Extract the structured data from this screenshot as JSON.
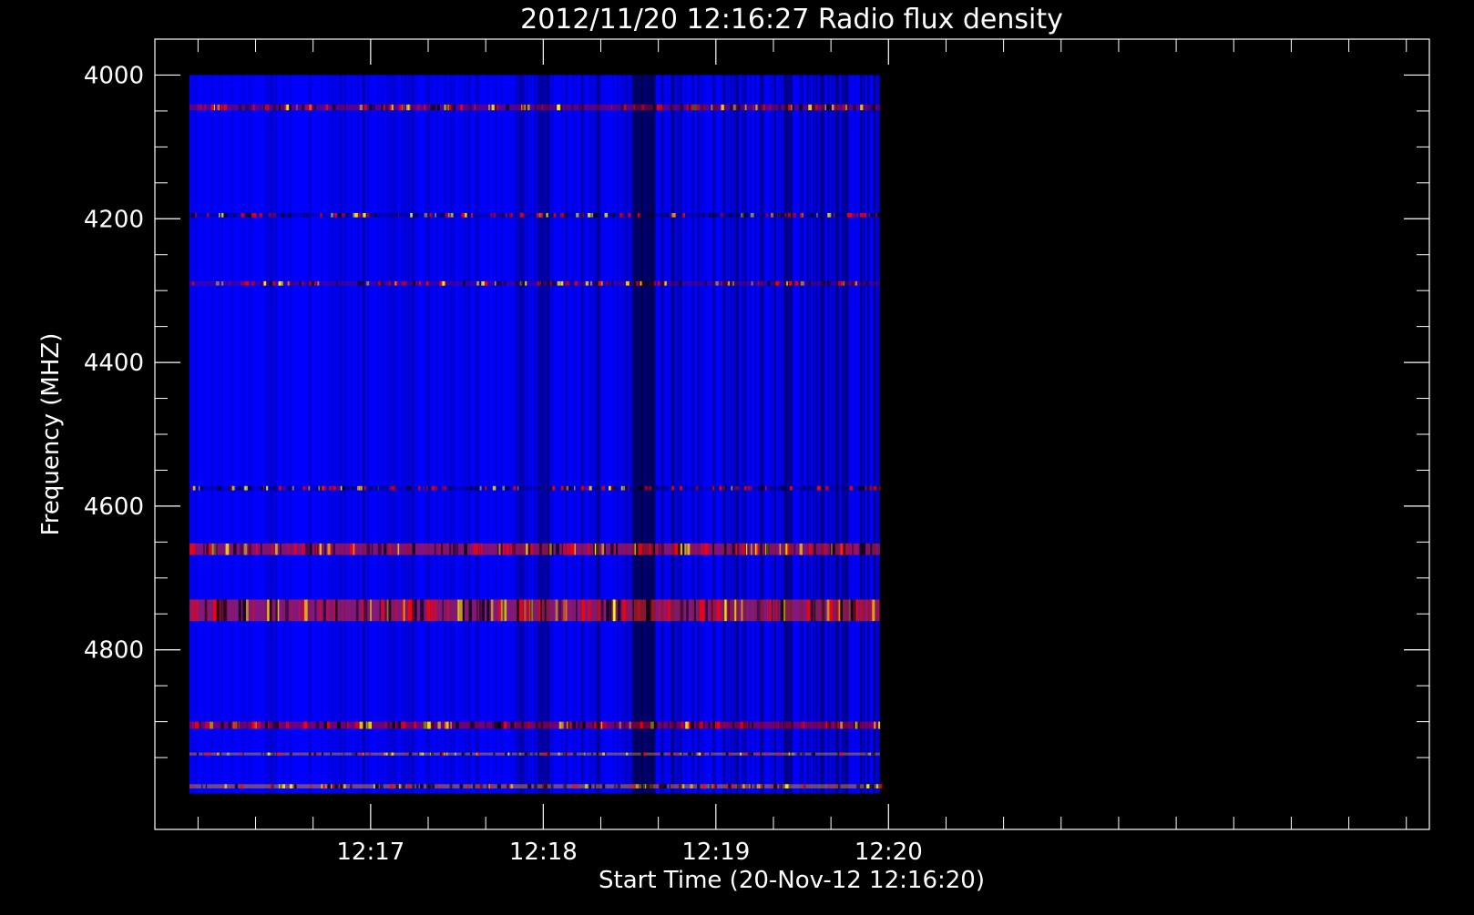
{
  "chart_data": {
    "type": "heatmap",
    "title": "2012/11/20 12:16:27 Radio flux density",
    "xlabel": "Start Time (20-Nov-12 12:16:20)",
    "ylabel": "Frequency (MHZ)",
    "ylim": [
      3950,
      5050
    ],
    "y_inverted": true,
    "xlim_seconds_after_start": [
      -35,
      408
    ],
    "y_ticks": [
      {
        "value": 4000,
        "label": "4000"
      },
      {
        "value": 4200,
        "label": "4200"
      },
      {
        "value": 4400,
        "label": "4400"
      },
      {
        "value": 4600,
        "label": "4600"
      },
      {
        "value": 4800,
        "label": "4800"
      }
    ],
    "y_minor_step": 50,
    "x_ticks": [
      {
        "value": 40,
        "label": "12:17"
      },
      {
        "value": 100,
        "label": "12:18"
      },
      {
        "value": 160,
        "label": "12:19"
      },
      {
        "value": 220,
        "label": "12:20"
      }
    ],
    "x_minor_step": 20,
    "data_extent": {
      "time_start": -23,
      "time_end": 217,
      "freq_start": 4000,
      "freq_end": 5000
    },
    "colormap": {
      "background": "#0000ff",
      "low": "#000000",
      "mid": "#ff0000",
      "high": "#ffff00"
    },
    "frequency_bands": [
      {
        "freq": 4045,
        "width": 8,
        "color": "#d40000",
        "strength": 0.7
      },
      {
        "freq": 4195,
        "width": 6,
        "color": "#000044",
        "strength": 0.5
      },
      {
        "freq": 4290,
        "width": 6,
        "color": "#c00000",
        "strength": 0.45
      },
      {
        "freq": 4575,
        "width": 6,
        "color": "#000044",
        "strength": 0.45
      },
      {
        "freq": 4660,
        "width": 16,
        "color": "#ff2200",
        "strength": 0.85
      },
      {
        "freq": 4745,
        "width": 30,
        "color": "#ff3000",
        "strength": 0.85
      },
      {
        "freq": 4905,
        "width": 10,
        "color": "#e00000",
        "strength": 0.8
      },
      {
        "freq": 4945,
        "width": 4,
        "color": "#ffcc00",
        "strength": 0.6
      },
      {
        "freq": 4990,
        "width": 6,
        "color": "#ffaa00",
        "strength": 0.7
      }
    ],
    "dark_time_stripes": [
      {
        "time": 135,
        "width": 8,
        "strength": 0.55
      },
      {
        "time": 100,
        "width": 4,
        "strength": 0.35
      },
      {
        "time": 185,
        "width": 3,
        "strength": 0.4
      },
      {
        "time": 205,
        "width": 2,
        "strength": 0.35
      }
    ]
  }
}
